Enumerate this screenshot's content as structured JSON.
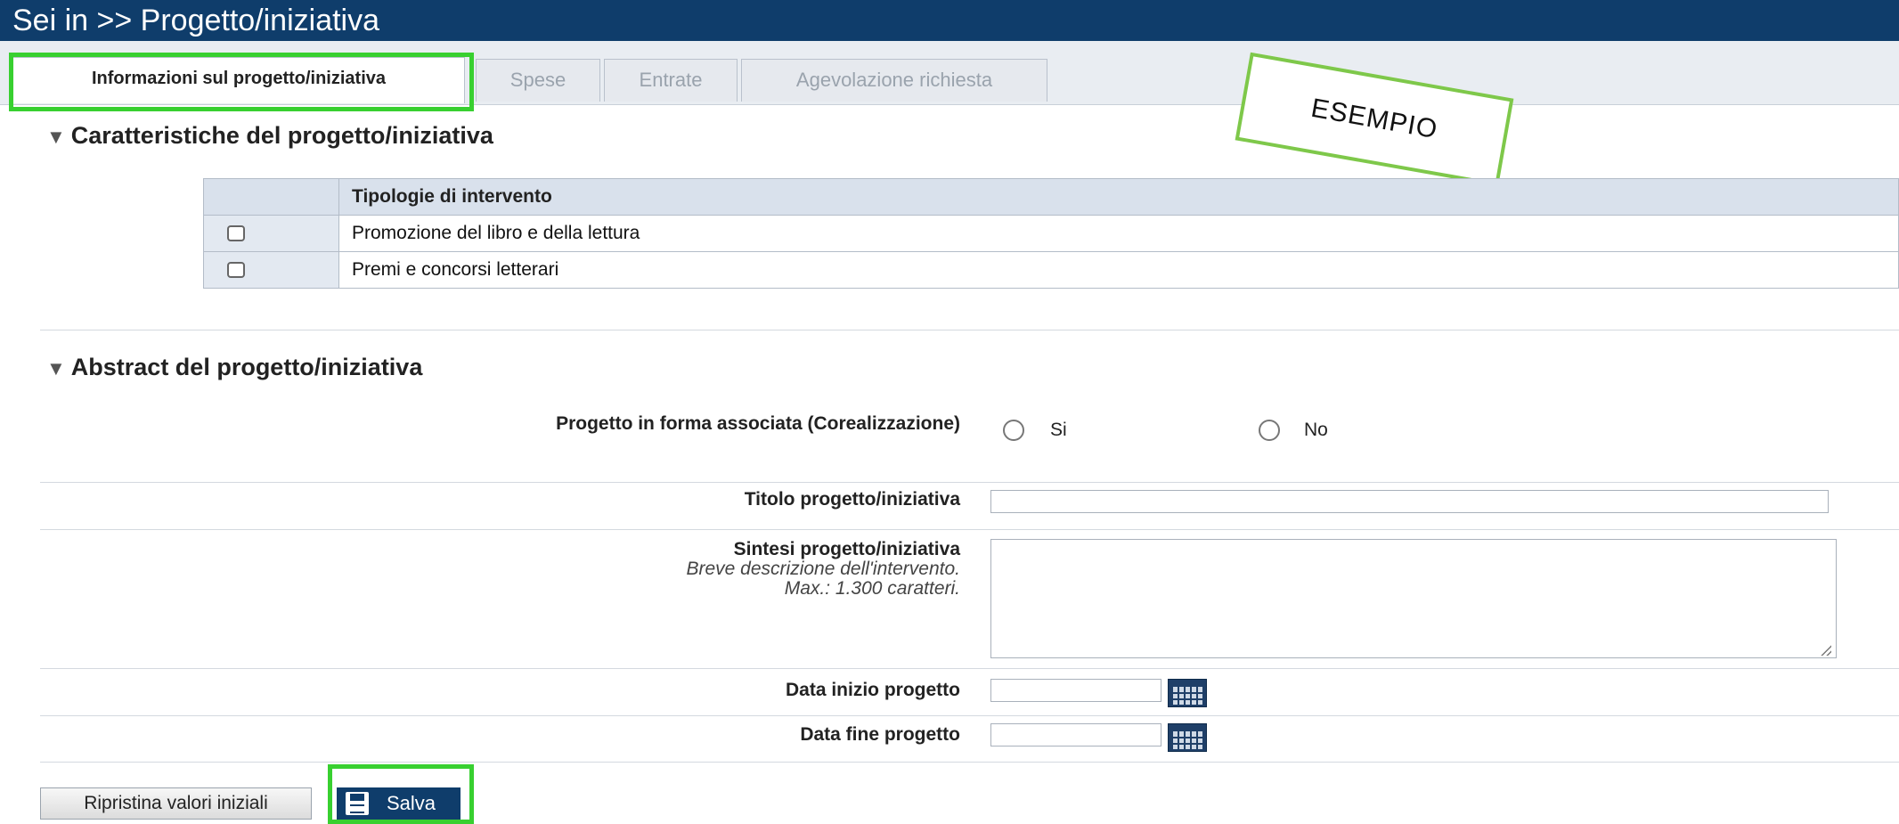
{
  "header": {
    "breadcrumb": "Sei in >> Progetto/iniziativa"
  },
  "tabs": [
    {
      "label": "Informazioni sul progetto/iniziativa",
      "active": true
    },
    {
      "label": "Spese",
      "active": false
    },
    {
      "label": "Entrate",
      "active": false
    },
    {
      "label": "Agevolazione richiesta",
      "active": false
    }
  ],
  "annotation": {
    "label": "ESEMPIO"
  },
  "section_caratteristiche": {
    "title": "Caratteristiche del progetto/iniziativa",
    "table": {
      "header": "Tipologie di intervento",
      "rows": [
        {
          "label": "Promozione del libro e della lettura",
          "checked": false
        },
        {
          "label": "Premi e concorsi letterari",
          "checked": false
        }
      ]
    }
  },
  "section_abstract": {
    "title": "Abstract del progetto/iniziativa",
    "associata": {
      "label": "Progetto in forma associata (Corealizzazione)",
      "options": [
        "Si",
        "No"
      ]
    },
    "titolo": {
      "label": "Titolo progetto/iniziativa",
      "value": ""
    },
    "sintesi": {
      "label": "Sintesi progetto/iniziativa",
      "hint1": "Breve descrizione dell'intervento.",
      "hint2": "Max.: 1.300 caratteri.",
      "value": ""
    },
    "data_inizio": {
      "label": "Data inizio progetto",
      "value": ""
    },
    "data_fine": {
      "label": "Data fine progetto",
      "value": ""
    }
  },
  "buttons": {
    "reset": "Ripristina valori iniziali",
    "save": "Salva"
  },
  "colors": {
    "header_bg": "#0f3d6b",
    "highlight": "#38d030",
    "annotation_border": "#7ec84a"
  }
}
